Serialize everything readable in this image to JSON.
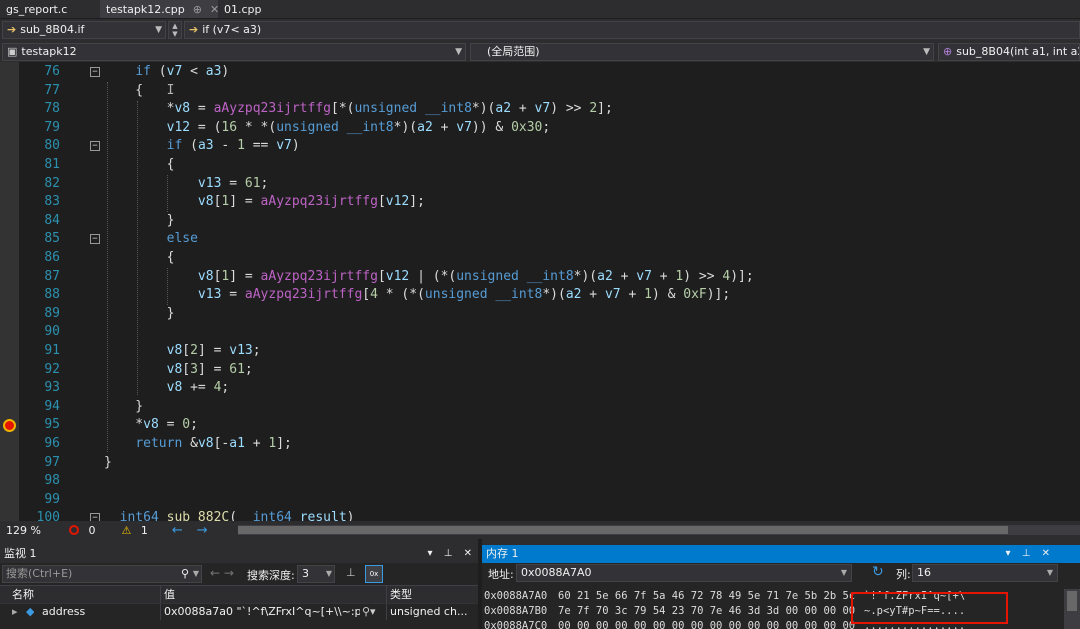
{
  "tabs": [
    {
      "label": "gs_report.c",
      "active": false,
      "pin": "",
      "close": ""
    },
    {
      "label": "testapk12.cpp",
      "active": true,
      "pin": "⊕",
      "close": "✕"
    },
    {
      "label": "01.cpp",
      "active": false,
      "pin": "",
      "close": ""
    }
  ],
  "nav": {
    "scope_func": "sub_8B04.if",
    "scope_branch": "if (v7< a3)",
    "project": "testapk12",
    "global_scope": "(全局范围)",
    "func_signature": "sub_8B04(int a1, int a2, in"
  },
  "code_lines": [
    {
      "n": "76",
      "fold": "−",
      "html": "    <span class=\"kw\">if</span> (<span class=\"var\">v7</span> &lt; <span class=\"var\">a3</span>)"
    },
    {
      "n": "77",
      "fold": "",
      "html": "    {   <span class=\"op\">I</span>"
    },
    {
      "n": "78",
      "fold": "",
      "html": "        *<span class=\"var\">v8</span> = <span class=\"glb\">aAyzpq23ijrtffg</span>[*(<span class=\"kw\">unsigned</span> <span class=\"kw\">__int8</span>*)(<span class=\"var\">a2</span> + <span class=\"var\">v7</span>) &gt;&gt; <span class=\"num\">2</span>];"
    },
    {
      "n": "79",
      "fold": "",
      "html": "        <span class=\"var\">v12</span> = (<span class=\"num\">16</span> * *(<span class=\"kw\">unsigned</span> <span class=\"kw\">__int8</span>*)(<span class=\"var\">a2</span> + <span class=\"var\">v7</span>)) &amp; <span class=\"num\">0x30</span>;"
    },
    {
      "n": "80",
      "fold": "−",
      "html": "        <span class=\"kw\">if</span> (<span class=\"var\">a3</span> - <span class=\"num\">1</span> == <span class=\"var\">v7</span>)"
    },
    {
      "n": "81",
      "fold": "",
      "html": "        {"
    },
    {
      "n": "82",
      "fold": "",
      "html": "            <span class=\"var\">v13</span> = <span class=\"num\">61</span>;"
    },
    {
      "n": "83",
      "fold": "",
      "html": "            <span class=\"var\">v8</span>[<span class=\"num\">1</span>] = <span class=\"glb\">aAyzpq23ijrtffg</span>[<span class=\"var\">v12</span>];"
    },
    {
      "n": "84",
      "fold": "",
      "html": "        }"
    },
    {
      "n": "85",
      "fold": "−",
      "html": "        <span class=\"kw\">else</span>"
    },
    {
      "n": "86",
      "fold": "",
      "html": "        {"
    },
    {
      "n": "87",
      "fold": "",
      "html": "            <span class=\"var\">v8</span>[<span class=\"num\">1</span>] = <span class=\"glb\">aAyzpq23ijrtffg</span>[<span class=\"var\">v12</span> | (*(<span class=\"kw\">unsigned</span> <span class=\"kw\">__int8</span>*)(<span class=\"var\">a2</span> + <span class=\"var\">v7</span> + <span class=\"num\">1</span>) &gt;&gt; <span class=\"num\">4</span>)];"
    },
    {
      "n": "88",
      "fold": "",
      "html": "            <span class=\"var\">v13</span> = <span class=\"glb\">aAyzpq23ijrtffg</span>[<span class=\"num\">4</span> * (*(<span class=\"kw\">unsigned</span> <span class=\"kw\">__int8</span>*)(<span class=\"var\">a2</span> + <span class=\"var\">v7</span> + <span class=\"num\">1</span>) &amp; <span class=\"num\">0xF</span>)];"
    },
    {
      "n": "89",
      "fold": "",
      "html": "        }"
    },
    {
      "n": "90",
      "fold": "",
      "html": ""
    },
    {
      "n": "91",
      "fold": "",
      "html": "        <span class=\"var\">v8</span>[<span class=\"num\">2</span>] = <span class=\"var\">v13</span>;"
    },
    {
      "n": "92",
      "fold": "",
      "html": "        <span class=\"var\">v8</span>[<span class=\"num\">3</span>] = <span class=\"num\">61</span>;"
    },
    {
      "n": "93",
      "fold": "",
      "html": "        <span class=\"var\">v8</span> += <span class=\"num\">4</span>;"
    },
    {
      "n": "94",
      "fold": "",
      "html": "    }"
    },
    {
      "n": "95",
      "fold": "",
      "html": "    *<span class=\"var\">v8</span> = <span class=\"num\">0</span>;"
    },
    {
      "n": "96",
      "fold": "",
      "html": "    <span class=\"kw\">return</span> &amp;<span class=\"var\">v8</span>[-<span class=\"var\">a1</span> + <span class=\"num\">1</span>];"
    },
    {
      "n": "97",
      "fold": "",
      "html": "}"
    },
    {
      "n": "98",
      "fold": "",
      "html": ""
    },
    {
      "n": "99",
      "fold": "",
      "html": ""
    },
    {
      "n": "100",
      "fold": "−",
      "html": "<span class=\"kw\">__int64</span> <span class=\"fn\">sub_882C</span>(<span class=\"kw\">__int64</span> <span class=\"var\">result</span>)"
    }
  ],
  "breakpoint_line": "95",
  "status": {
    "zoom": "129 %",
    "errors": "0",
    "warnings": "1"
  },
  "watch": {
    "title": "监视 1",
    "search_placeholder": "搜索(Ctrl+E)",
    "depth_label": "搜索深度:",
    "depth_value": "3",
    "col_name": "名称",
    "col_value": "值",
    "col_type": "类型",
    "rows": [
      {
        "name": "address",
        "value": "0x0088a7a0 \"`!^f\\ZFrxI^q~[+\\\\~:p<yT#...",
        "type": "unsigned ch..."
      }
    ]
  },
  "memory": {
    "title": "内存 1",
    "address_label": "地址:",
    "address_value": "0x0088A7A0",
    "columns_label": "列:",
    "columns_value": "16",
    "lines": [
      {
        "addr": "0x0088A7A0",
        "bytes": "60 21 5e 66 7f 5a 46 72 78 49 5e 71 7e 5b 2b 5c",
        "ascii": "`!^f.ZFrxI^q~[+\\"
      },
      {
        "addr": "0x0088A7B0",
        "bytes": "7e 7f 70 3c 79 54 23 70 7e 46 3d 3d 00 00 00 00",
        "ascii": "~.p<yT#p~F==...."
      },
      {
        "addr": "0x0088A7C0",
        "bytes": "00 00 00 00 00 00 00 00 00 00 00 00 00 00 00 00",
        "ascii": "................"
      }
    ]
  },
  "pane_controls": {
    "dropdown": "▾",
    "pin": "⊥",
    "close": "✕"
  }
}
